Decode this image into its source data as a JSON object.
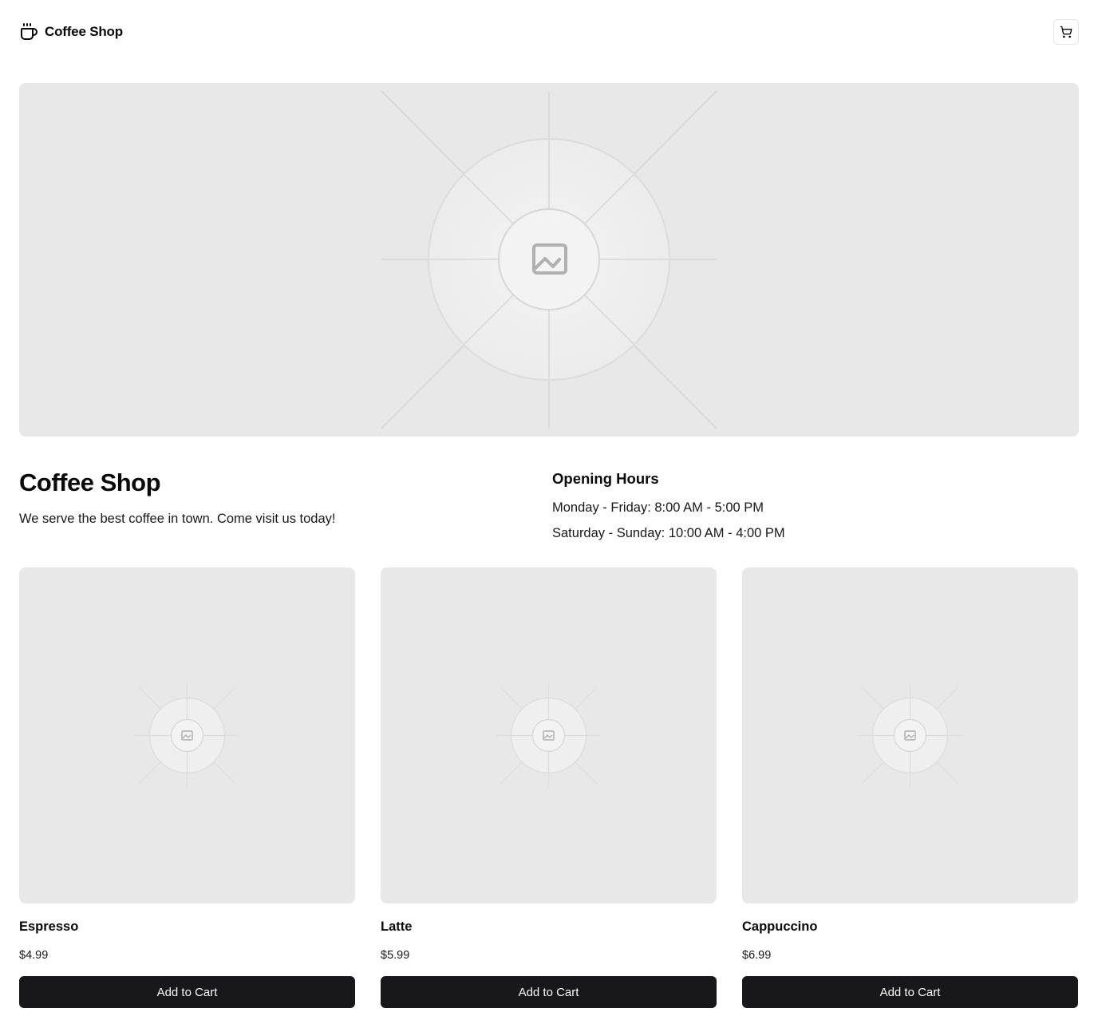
{
  "header": {
    "brand_name": "Coffee Shop",
    "brand_icon": "coffee-cup-icon",
    "cart_icon": "shopping-cart-icon"
  },
  "hero": {
    "image_icon": "image-placeholder-icon"
  },
  "info": {
    "title": "Coffee Shop",
    "description": "We serve the best coffee in town. Come visit us today!",
    "hours_title": "Opening Hours",
    "hours": [
      "Monday - Friday: 8:00 AM - 5:00 PM",
      "Saturday - Sunday: 10:00 AM - 4:00 PM"
    ]
  },
  "products": [
    {
      "name": "Espresso",
      "price": "$4.99",
      "button_label": "Add to Cart"
    },
    {
      "name": "Latte",
      "price": "$5.99",
      "button_label": "Add to Cart"
    },
    {
      "name": "Cappuccino",
      "price": "$6.99",
      "button_label": "Add to Cart"
    }
  ],
  "colors": {
    "placeholder_bg": "#e8e8e8",
    "button_bg": "#18181b",
    "button_text": "#fafafa",
    "text": "#09090b"
  }
}
